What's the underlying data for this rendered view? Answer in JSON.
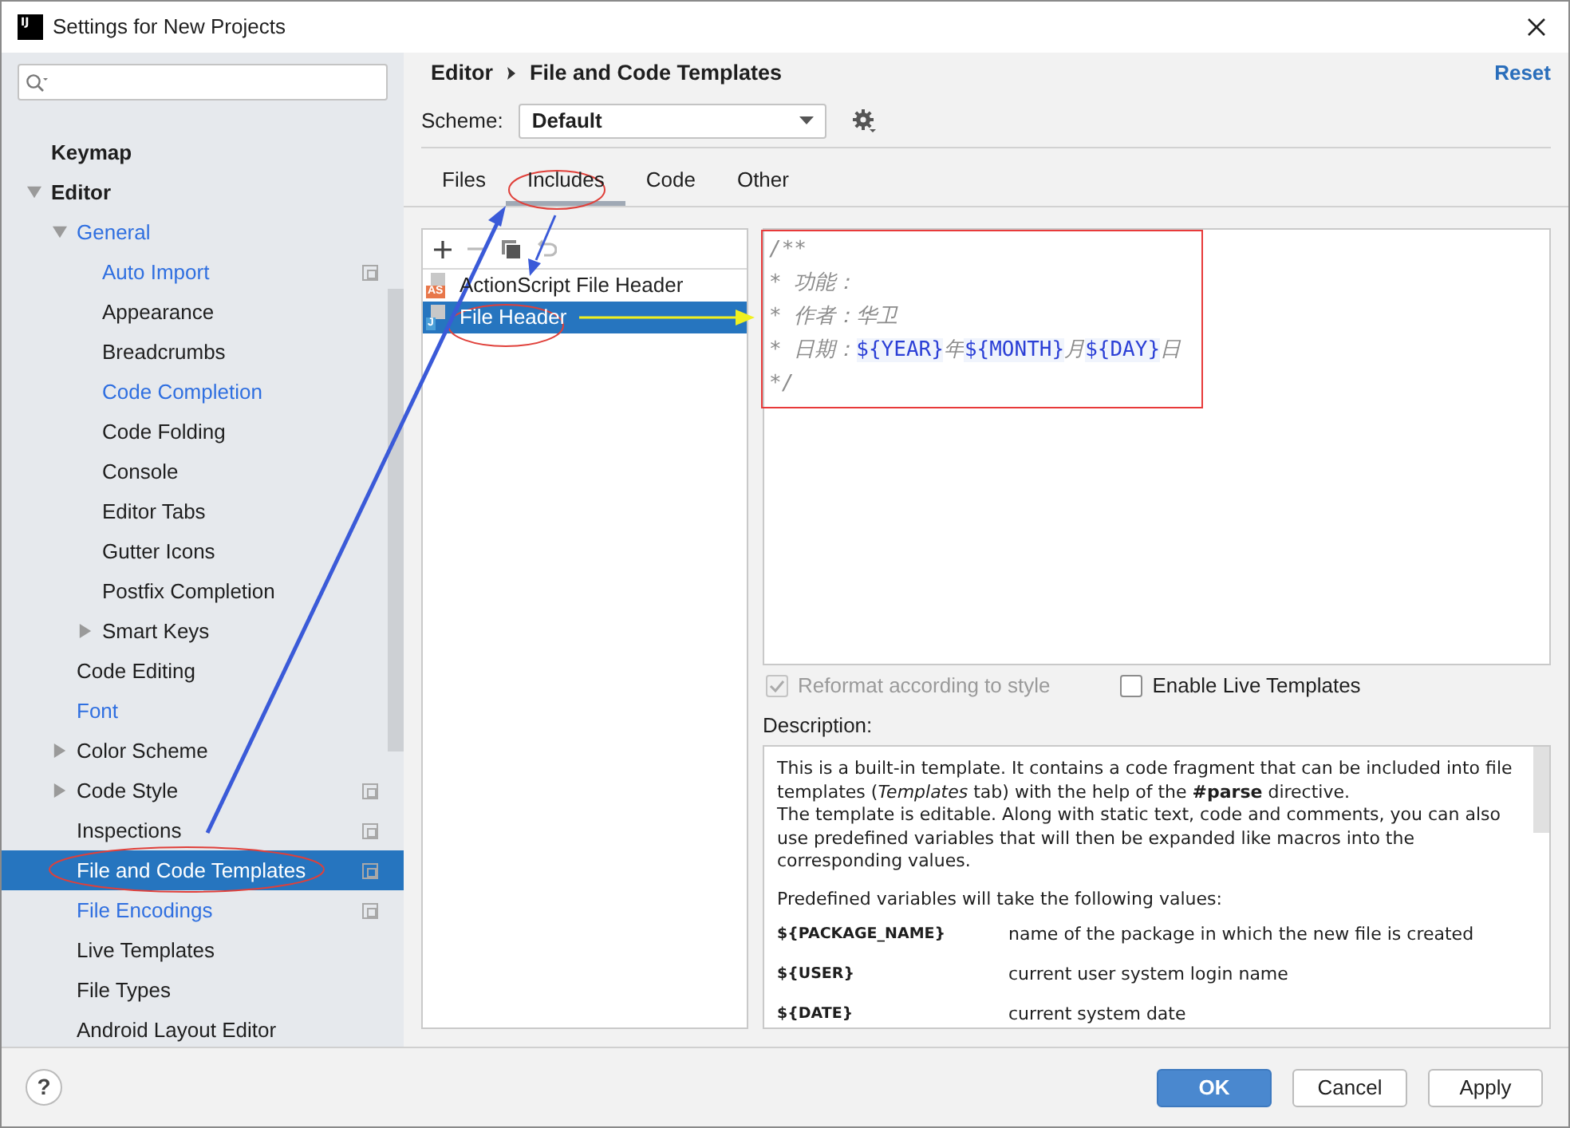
{
  "window": {
    "title": "Settings for New Projects",
    "logo": "IJ"
  },
  "sidebar": {
    "items": [
      {
        "label": "Keymap",
        "bold": true,
        "modified": false,
        "selected": false
      },
      {
        "label": "Editor",
        "bold": true,
        "modified": false,
        "selected": false,
        "expanded": true,
        "children": [
          {
            "label": "General",
            "modified": true,
            "selected": false,
            "expanded": true,
            "children": [
              {
                "label": "Auto Import",
                "modified": true,
                "selected": false,
                "project_level": true
              },
              {
                "label": "Appearance",
                "modified": false,
                "selected": false
              },
              {
                "label": "Breadcrumbs",
                "modified": false,
                "selected": false
              },
              {
                "label": "Code Completion",
                "modified": true,
                "selected": false
              },
              {
                "label": "Code Folding",
                "modified": false,
                "selected": false
              },
              {
                "label": "Console",
                "modified": false,
                "selected": false
              },
              {
                "label": "Editor Tabs",
                "modified": false,
                "selected": false
              },
              {
                "label": "Gutter Icons",
                "modified": false,
                "selected": false
              },
              {
                "label": "Postfix Completion",
                "modified": false,
                "selected": false
              },
              {
                "label": "Smart Keys",
                "modified": false,
                "selected": false,
                "expanded": false
              }
            ]
          },
          {
            "label": "Code Editing",
            "modified": false,
            "selected": false
          },
          {
            "label": "Font",
            "modified": true,
            "selected": false
          },
          {
            "label": "Color Scheme",
            "modified": false,
            "selected": false,
            "expanded": false
          },
          {
            "label": "Code Style",
            "modified": false,
            "selected": false,
            "expanded": false,
            "project_level": true
          },
          {
            "label": "Inspections",
            "modified": false,
            "selected": false,
            "project_level": true
          },
          {
            "label": "File and Code Templates",
            "modified": false,
            "selected": true,
            "project_level": true
          },
          {
            "label": "File Encodings",
            "modified": true,
            "selected": false,
            "project_level": true
          },
          {
            "label": "Live Templates",
            "modified": false,
            "selected": false
          },
          {
            "label": "File Types",
            "modified": false,
            "selected": false
          },
          {
            "label": "Android Layout Editor",
            "modified": false,
            "selected": false
          }
        ]
      }
    ]
  },
  "breadcrumb": [
    "Editor",
    "File and Code Templates"
  ],
  "reset": "Reset",
  "scheme": {
    "label": "Scheme:",
    "value": "Default"
  },
  "tabs": [
    {
      "label": "Files",
      "selected": false
    },
    {
      "label": "Includes",
      "selected": true
    },
    {
      "label": "Code",
      "selected": false
    },
    {
      "label": "Other",
      "selected": false
    }
  ],
  "templates": [
    {
      "label": "ActionScript File Header",
      "badge": "AS",
      "kind": "actionscript",
      "selected": false
    },
    {
      "label": "File Header",
      "badge": "J",
      "kind": "java",
      "selected": true
    }
  ],
  "editor": {
    "lines": [
      [
        {
          "text": "/**",
          "kind": "comment"
        }
      ],
      [
        {
          "text": "* 功能：",
          "kind": "comment"
        }
      ],
      [
        {
          "text": "* 作者：华卫",
          "kind": "comment"
        }
      ],
      [
        {
          "text": "* 日期：",
          "kind": "comment"
        },
        {
          "text": "${YEAR}",
          "kind": "variable"
        },
        {
          "text": "年",
          "kind": "comment"
        },
        {
          "text": "${MONTH}",
          "kind": "variable"
        },
        {
          "text": "月",
          "kind": "comment"
        },
        {
          "text": "${DAY}",
          "kind": "variable"
        },
        {
          "text": "日",
          "kind": "comment"
        }
      ],
      [
        {
          "text": "*/",
          "kind": "comment"
        }
      ]
    ]
  },
  "options": [
    {
      "label": "Reformat according to style",
      "checked": true,
      "disabled": true
    },
    {
      "label": "Enable Live Templates",
      "checked": false,
      "disabled": false
    }
  ],
  "description": {
    "label": "Description:",
    "paragraphs": [
      "This is a built-in template. It contains a code fragment that can be included into file templates (*Templates* tab) with the help of the **#parse** directive.",
      "The template is editable. Along with static text, code and comments, you can also use predefined variables that will then be expanded like macros into the corresponding values.",
      "Predefined variables will take the following values:"
    ],
    "variables": [
      {
        "name": "${PACKAGE_NAME}",
        "meaning": "name of the package in which the new file is created"
      },
      {
        "name": "${USER}",
        "meaning": "current user system login name"
      },
      {
        "name": "${DATE}",
        "meaning": "current system date"
      }
    ]
  },
  "buttons": [
    {
      "label": "OK",
      "kind": "primary"
    },
    {
      "label": "Cancel",
      "kind": "normal"
    },
    {
      "label": "Apply",
      "kind": "normal"
    }
  ],
  "help": "?"
}
